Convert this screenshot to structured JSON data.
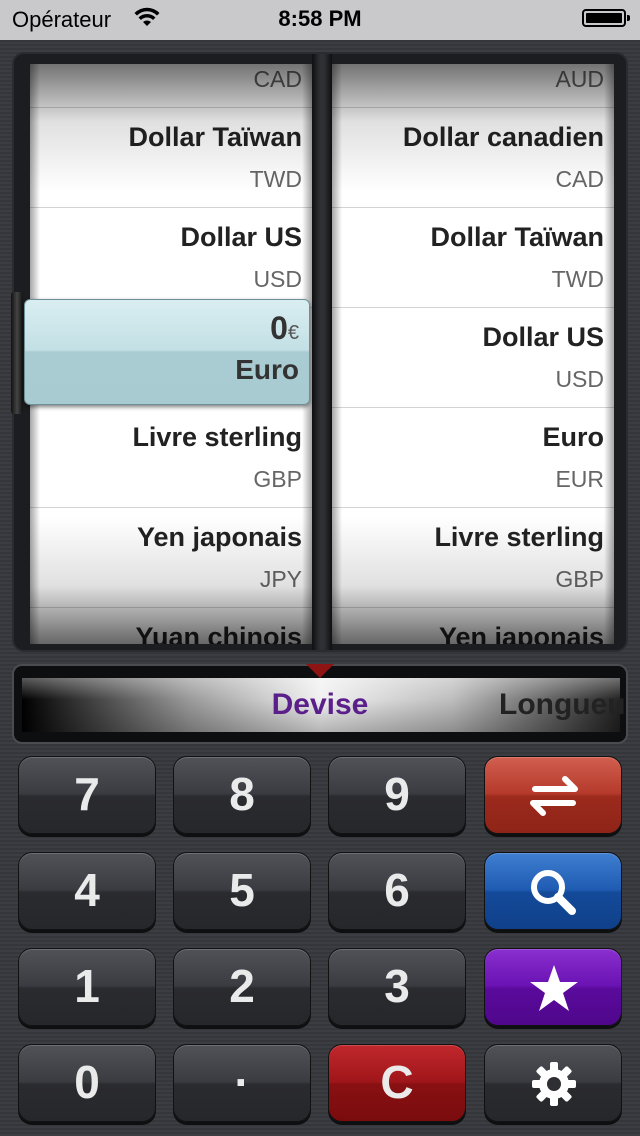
{
  "status_bar": {
    "carrier": "Opérateur",
    "time": "8:58 PM"
  },
  "from_wheel": {
    "items": [
      {
        "name": "",
        "code": "CAD"
      },
      {
        "name": "Dollar Taïwan",
        "code": "TWD"
      },
      {
        "name": "Dollar US",
        "code": "USD"
      },
      {
        "name": "Livre sterling",
        "code": "GBP"
      },
      {
        "name": "Yen japonais",
        "code": "JPY"
      },
      {
        "name": "Yuan chinois",
        "code": ""
      }
    ],
    "selected": {
      "amount": "0",
      "symbol": "€",
      "name": "Euro"
    }
  },
  "to_wheel": {
    "items": [
      {
        "name": "",
        "code": "AUD"
      },
      {
        "name": "Dollar canadien",
        "code": "CAD"
      },
      {
        "name": "Dollar Taïwan",
        "code": "TWD"
      },
      {
        "name": "Dollar US",
        "code": "USD"
      },
      {
        "name": "Euro",
        "code": "EUR"
      },
      {
        "name": "Livre sterling",
        "code": "GBP"
      },
      {
        "name": "Yen japonais",
        "code": ""
      }
    ]
  },
  "category": {
    "current": "Devise",
    "next": "Longueur"
  },
  "keypad": {
    "keys": [
      "7",
      "8",
      "9",
      "4",
      "5",
      "6",
      "1",
      "2",
      "3",
      "0",
      "·",
      "C"
    ],
    "function_icons": [
      "swap-icon",
      "search-icon",
      "star-icon",
      "gear-icon"
    ]
  },
  "colors": {
    "swap": "#b53a2b",
    "search": "#1f5cb3",
    "favorite": "#6a12b3",
    "clear": "#a0161a",
    "category_text": "#5a1f8a"
  }
}
